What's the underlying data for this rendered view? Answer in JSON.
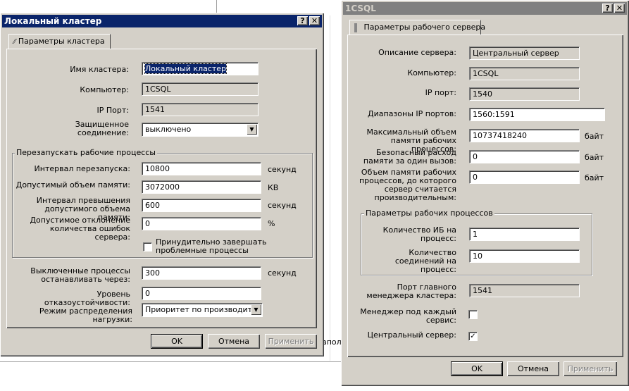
{
  "background": {
    "partial_text": "аполн"
  },
  "cluster_dialog": {
    "title": "Локальный кластер",
    "help_btn": "?",
    "close_btn": "✕",
    "tab_label": "Параметры кластера",
    "cluster_name_label": "Имя кластера:",
    "cluster_name_value": "Локальный кластер",
    "computer_label": "Компьютер:",
    "computer_value": "1CSQL",
    "ip_port_label": "IP Порт:",
    "ip_port_value": "1541",
    "secure_label": "Защищенное соединение:",
    "secure_value": "выключено",
    "restart_group_title": "Перезапускать рабочие процессы",
    "restart_interval_label": "Интервал перезапуска:",
    "restart_interval_value": "10800",
    "restart_interval_unit": "секунд",
    "allowed_memory_label": "Допустимый объем памяти:",
    "allowed_memory_value": "3072000",
    "allowed_memory_unit": "КВ",
    "memory_exceed_label": "Интервал превышения допустимого объема памяти:",
    "memory_exceed_value": "600",
    "memory_exceed_unit": "секунд",
    "error_deviation_label": "Допустимое отклонение количества ошибок сервера:",
    "error_deviation_value": "0",
    "error_deviation_unit": "%",
    "force_terminate_label": "Принудительно завершать проблемные процессы",
    "disabled_stop_label": "Выключенные процессы останавливать через:",
    "disabled_stop_value": "300",
    "disabled_stop_unit": "секунд",
    "fault_tolerance_label": "Уровень отказоустойчивости:",
    "fault_tolerance_value": "0",
    "load_mode_label": "Режим распределения нагрузки:",
    "load_mode_value": "Приоритет по производительности",
    "ok": "OK",
    "cancel": "Отмена",
    "apply": "Применить"
  },
  "server_dialog": {
    "title": "1CSQL",
    "help_btn": "?",
    "close_btn": "✕",
    "tab_label": "Параметры рабочего сервера",
    "description_label": "Описание сервера:",
    "description_value": "Центральный сервер",
    "computer_label": "Компьютер:",
    "computer_value": "1CSQL",
    "ip_port_label": "IP порт:",
    "ip_port_value": "1540",
    "ip_ranges_label": "Диапазоны IP портов:",
    "ip_ranges_value": "1560:1591",
    "max_memory_label": "Максимальный объем памяти рабочих процессов:",
    "max_memory_value": "10737418240",
    "max_memory_unit": "байт",
    "safe_usage_label": "Безопасный расход памяти за один вызов:",
    "safe_usage_value": "0",
    "safe_usage_unit": "байт",
    "memory_threshold_label": "Объем памяти рабочих процессов, до которого сервер считается производительным:",
    "memory_threshold_value": "0",
    "memory_threshold_unit": "байт",
    "worker_group_title": "Параметры рабочих процессов",
    "ib_per_process_label": "Количество ИБ на процесс:",
    "ib_per_process_value": "1",
    "conn_per_process_label": "Количество соединений на процесс:",
    "conn_per_process_value": "10",
    "manager_port_label": "Порт главного менеджера кластера:",
    "manager_port_value": "1541",
    "manager_per_service_label": "Менеджер под каждый сервис:",
    "manager_per_service_checked": false,
    "central_server_label": "Центральный сервер:",
    "central_server_checked": true,
    "check_mark": "✓",
    "ok": "OK",
    "cancel": "Отмена",
    "apply": "Применить"
  }
}
